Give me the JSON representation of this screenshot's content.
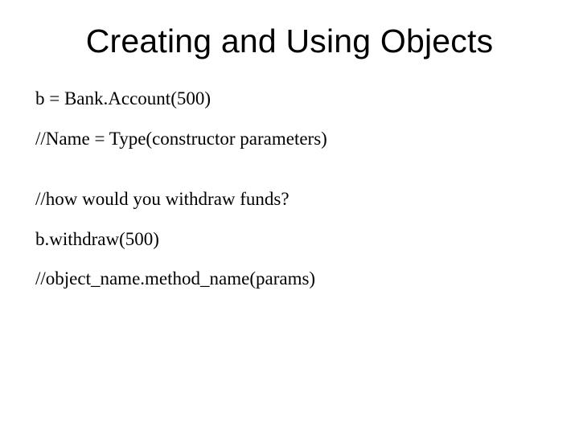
{
  "slide": {
    "title": "Creating and Using Objects",
    "lines": {
      "l1": "b = Bank.Account(500)",
      "l2": "//Name = Type(constructor parameters)",
      "l3": "//how would you withdraw funds?",
      "l4": "b.withdraw(500)",
      "l5": "//object_name.method_name(params)"
    }
  }
}
